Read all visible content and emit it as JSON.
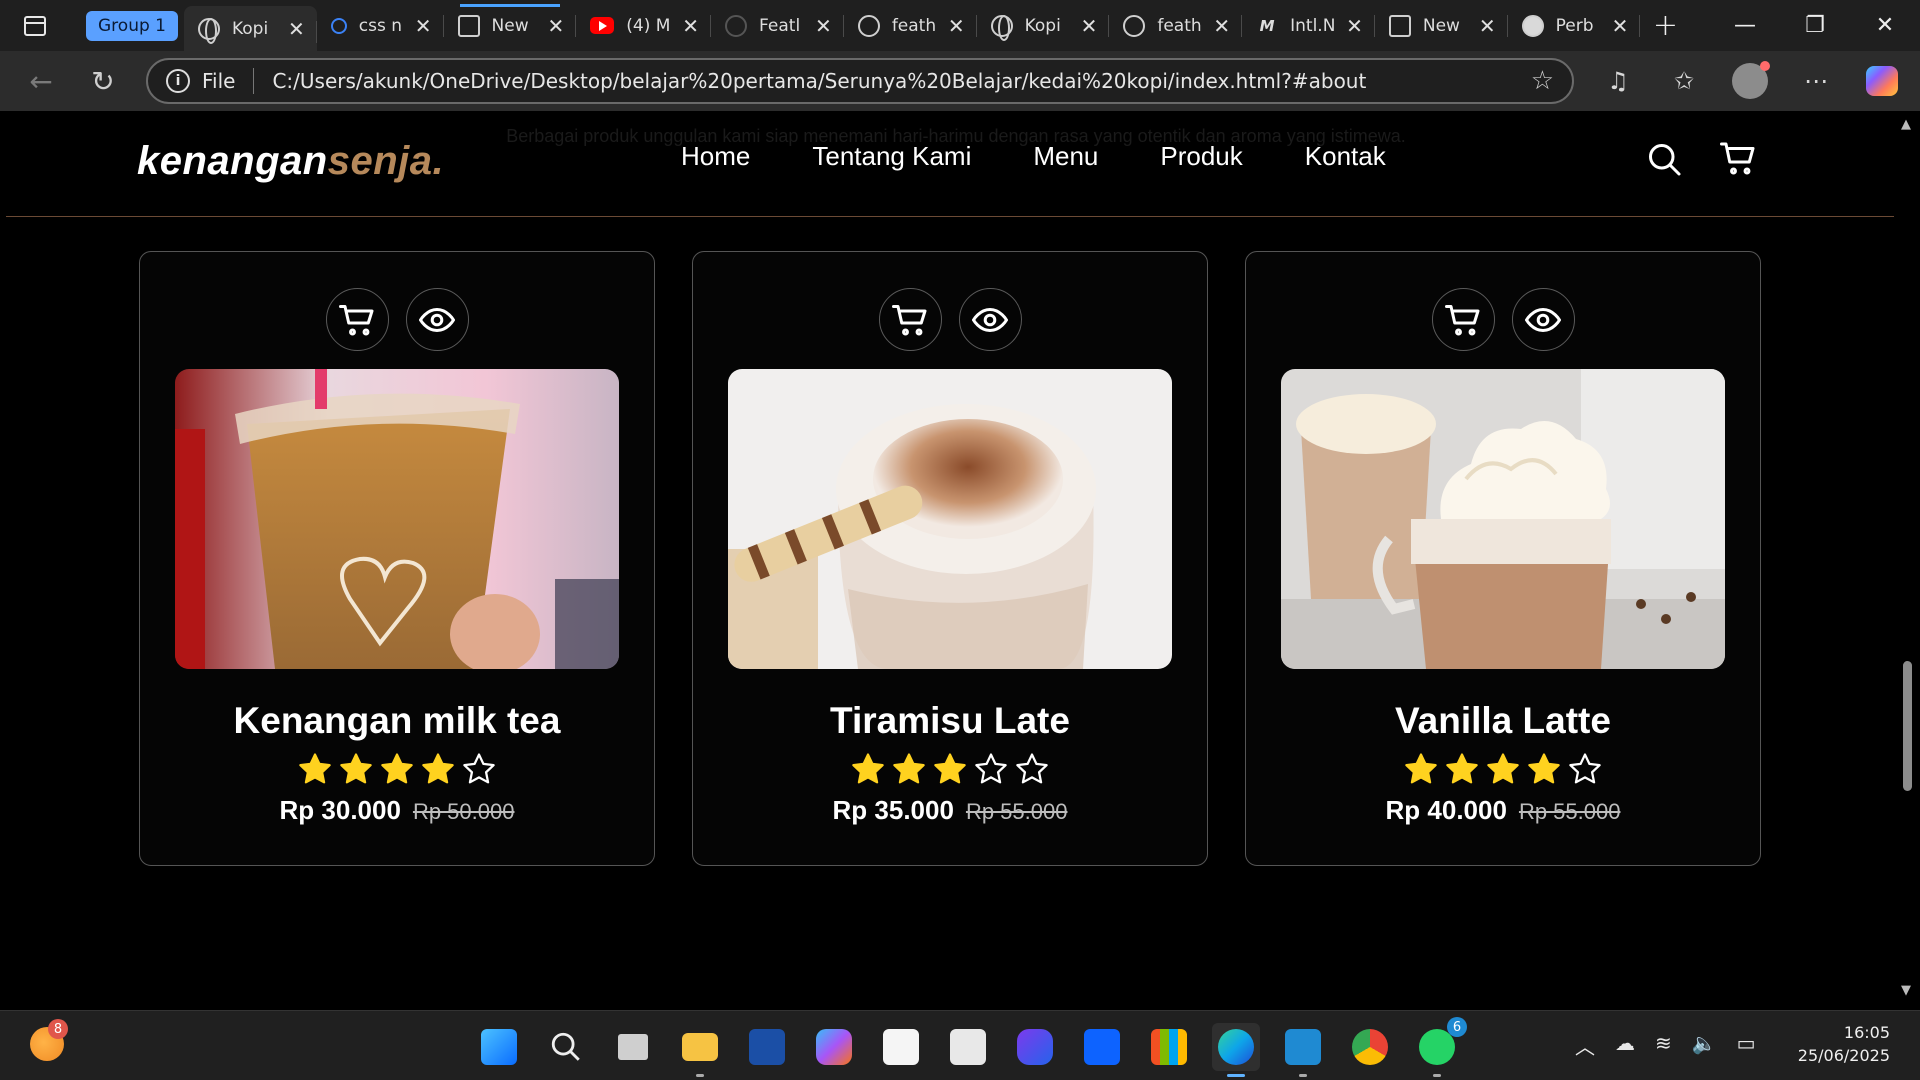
{
  "browser": {
    "group_label": "Group 1",
    "tabs": [
      {
        "label": "Kopi",
        "icon": "globe-icon",
        "active": true
      },
      {
        "label": "css n",
        "icon": "search-icon"
      },
      {
        "label": "New",
        "icon": "page-icon"
      },
      {
        "label": "(4) M",
        "icon": "youtube-icon"
      },
      {
        "label": "Featl",
        "icon": "feather-icon"
      },
      {
        "label": "feath",
        "icon": "github-icon"
      },
      {
        "label": "Kopi",
        "icon": "globe-icon"
      },
      {
        "label": "feath",
        "icon": "github-icon"
      },
      {
        "label": "Intl.N",
        "icon": "mdn-icon"
      },
      {
        "label": "New",
        "icon": "page-icon"
      },
      {
        "label": "Perb",
        "icon": "perplexity-icon"
      }
    ],
    "address": {
      "scheme_label": "File",
      "url": "C:/Users/akunk/OneDrive/Desktop/belajar%20pertama/Serunya%20Belajar/kedai%20kopi/index.html?#about"
    }
  },
  "site": {
    "logo_main": "kenangan",
    "logo_accent": "senja.",
    "ghost_text": "Berbagai produk unggulan kami siap menemani hari-harimu dengan rasa yang otentik dan aroma yang istimewa.",
    "menu": [
      "Home",
      "Tentang Kami",
      "Menu",
      "Produk",
      "Kontak"
    ],
    "accent_color": "#b6895b"
  },
  "products": [
    {
      "name": "Kenangan milk tea",
      "rating": 4,
      "price": "Rp 30.000",
      "old_price": "Rp 50.000"
    },
    {
      "name": "Tiramisu Late",
      "rating": 3,
      "price": "Rp 35.000",
      "old_price": "Rp 55.000"
    },
    {
      "name": "Vanilla Latte",
      "rating": 4,
      "price": "Rp 40.000",
      "old_price": "Rp 55.000"
    }
  ],
  "taskbar": {
    "weather_badge": "8",
    "whatsapp_badge": "6",
    "time": "16:05",
    "date": "25/06/2025"
  }
}
